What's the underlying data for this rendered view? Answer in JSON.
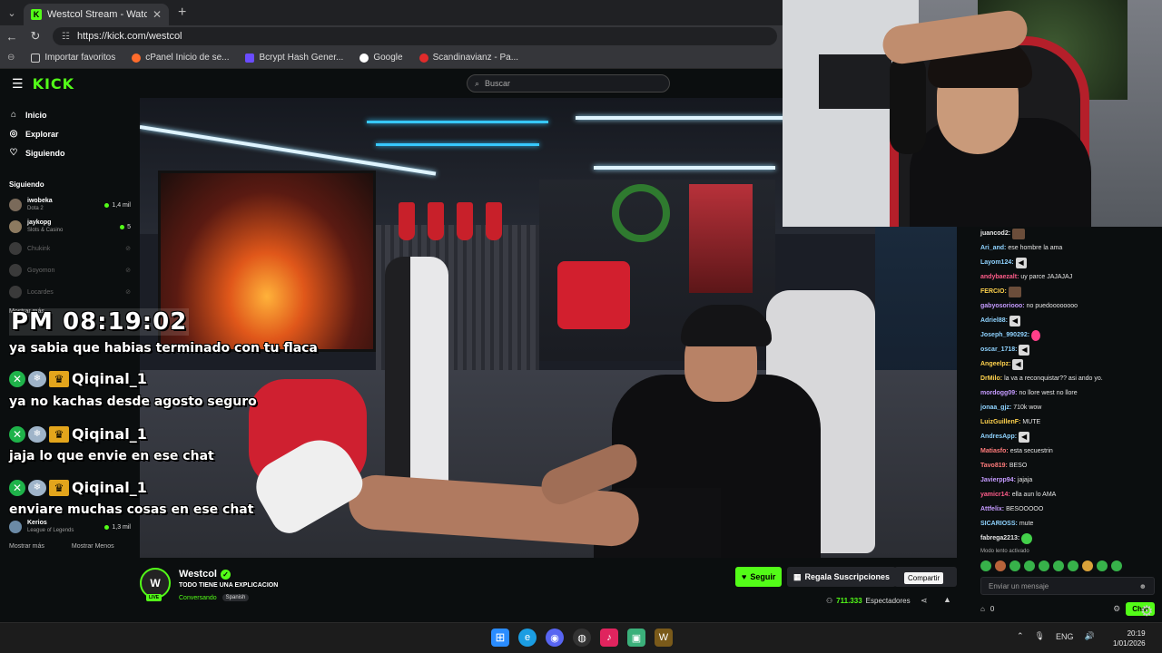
{
  "browser": {
    "tab_title": "Westcol Stream - Watch Live on Kick",
    "url": "https://kick.com/westcol",
    "bookmarks": [
      "Importar favoritos",
      "cPanel Inicio de se...",
      "Bcrypt Hash Gener...",
      "Google",
      "Scandinavianz - Pa..."
    ]
  },
  "site": {
    "logo": "KICK",
    "search_placeholder": "Buscar"
  },
  "sidebar": {
    "nav": [
      {
        "label": "Inicio",
        "icon": "home-icon"
      },
      {
        "label": "Explorar",
        "icon": "compass-icon"
      },
      {
        "label": "Siguiendo",
        "icon": "heart-icon"
      }
    ],
    "following_heading": "Siguiendo",
    "channels": [
      {
        "name": "iwobeka",
        "category": "Dota 2",
        "viewers": "1,4 mil",
        "live": true
      },
      {
        "name": "jaykopg",
        "category": "Slots & Casino",
        "viewers": "5",
        "live": true
      },
      {
        "name": "Chukink",
        "category": "",
        "viewers": "",
        "live": false
      },
      {
        "name": "Goyomon",
        "category": "",
        "viewers": "",
        "live": false
      },
      {
        "name": "Locardes",
        "category": "",
        "viewers": "",
        "live": false
      }
    ],
    "show_more": "Mostrar más",
    "bottom_channels": [
      {
        "name": "Kerios",
        "category": "League of Legends",
        "viewers": "1,3 mil",
        "live": true
      }
    ],
    "show_more_bottom": "Mostrar más",
    "show_less": "Mostrar Menos"
  },
  "overlay": {
    "clock": "PM 08:19:02",
    "lines": [
      "ya sabia que habias terminado con tu flaca",
      "ya no kachas desde agosto seguro",
      "jaja lo que envie en ese chat",
      "enviare muchas cosas en ese chat"
    ],
    "username": "Qiqinal_1"
  },
  "channel": {
    "name": "Westcol",
    "title": "TODO TIENE UNA EXPLICACION",
    "category": "Conversando",
    "language": "Spanish",
    "live_label": "LIVE",
    "avatar_letter": "W",
    "follow_label": "Seguir",
    "gift_label": "Regala Suscripciones",
    "share_tooltip": "Compartir",
    "viewers": "711.333",
    "viewers_label": "Espectadores"
  },
  "chat": {
    "messages": [
      {
        "user": "juancod2:",
        "text": "",
        "color": "#e6e6e6",
        "emote": "brown"
      },
      {
        "user": "Ari_and:",
        "text": "ese hombre la ama",
        "color": "#8fd3ff",
        "emote": ""
      },
      {
        "user": "Layom124:",
        "text": "",
        "color": "#8fd3ff",
        "emote": "speaker"
      },
      {
        "user": "andybaezalt:",
        "text": "uy parce JAJAJAJ",
        "color": "#ff5c8a",
        "emote": ""
      },
      {
        "user": "FERCIO:",
        "text": "",
        "color": "#ffd24d",
        "emote": "brown"
      },
      {
        "user": "gabyosoriooo:",
        "text": "no puedoooooooo",
        "color": "#c59bff",
        "emote": ""
      },
      {
        "user": "Adriel88:",
        "text": "",
        "color": "#8fd3ff",
        "emote": "speaker"
      },
      {
        "user": "Joseph_990292:",
        "text": "",
        "color": "#8fd3ff",
        "emote": "pink"
      },
      {
        "user": "oscar_1718:",
        "text": "",
        "color": "#8fd3ff",
        "emote": "speaker"
      },
      {
        "user": "Angeelpz:",
        "text": "",
        "color": "#ffd24d",
        "emote": "speaker"
      },
      {
        "user": "DrMilo:",
        "text": "la va a reconquistar?? asi ando yo.",
        "color": "#ffd24d",
        "emote": ""
      },
      {
        "user": "mordogg09:",
        "text": "no llore west no llore",
        "color": "#c59bff",
        "emote": ""
      },
      {
        "user": "jonaa_gjz:",
        "text": "710k wow",
        "color": "#8fd3ff",
        "emote": ""
      },
      {
        "user": "LuizGuillenF:",
        "text": "MUTE",
        "color": "#ffd24d",
        "emote": ""
      },
      {
        "user": "AndresApp:",
        "text": "",
        "color": "#8fd3ff",
        "emote": "speaker"
      },
      {
        "user": "Matiasfo:",
        "text": "esta secuestrin",
        "color": "#ff7b7b",
        "emote": ""
      },
      {
        "user": "Tavo819:",
        "text": "BESO",
        "color": "#ff7b7b",
        "emote": ""
      },
      {
        "user": "Javierpp94:",
        "text": "jajaja",
        "color": "#c59bff",
        "emote": ""
      },
      {
        "user": "yamicr14:",
        "text": "ella aun lo AMA",
        "color": "#ff5c8a",
        "emote": ""
      },
      {
        "user": "Attfelix:",
        "text": "BESOOOOO",
        "color": "#c59bff",
        "emote": ""
      },
      {
        "user": "SICARIOSS:",
        "text": "mute",
        "color": "#8fd3ff",
        "emote": ""
      },
      {
        "user": "fabrega2213:",
        "text": "",
        "color": "#e6e6e6",
        "emote": "green"
      }
    ],
    "slow_mode": "Modo lento activado",
    "input_placeholder": "Enviar un mensaje",
    "points": "0",
    "send_label": "Chat"
  },
  "taskbar": {
    "language": "ENG",
    "time": "20:19",
    "date": "1/01/2026"
  }
}
